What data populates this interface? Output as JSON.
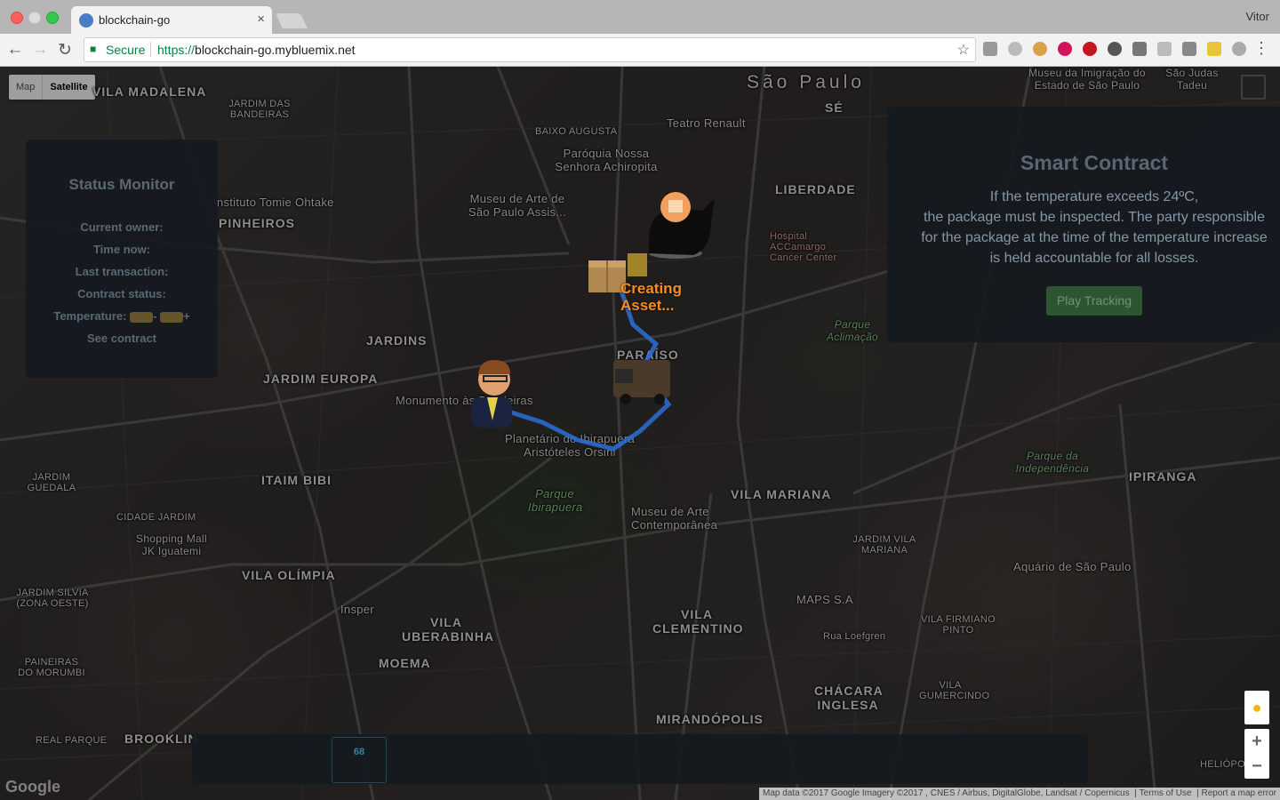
{
  "browser": {
    "tab_title": "blockchain-go",
    "tab_close": "×",
    "profile_name": "Vitor",
    "secure_label": "Secure",
    "url_scheme": "https://",
    "url_host": "blockchain-go.mybluemix.net"
  },
  "map": {
    "type_options": [
      "Map",
      "Satellite"
    ],
    "selected_type": "Satellite",
    "labels": [
      "São Paulo",
      "SÉ",
      "VILA MADALENA",
      "JARDIM DAS BANDEIRAS",
      "LIBERDADE",
      "BAIXO AUGUSTA",
      "PINHEIROS",
      "JARDINS",
      "JARDIM EUROPA",
      "PARAÍSO",
      "ITAIM BIBI",
      "VILA MARIANA",
      "IPIRANGA",
      "VILA OLÍMPIA",
      "VILA UBERABINHA",
      "MOEMA",
      "VILA CLEMENTINO",
      "MIRANDÓPOLIS",
      "BROOKLIN",
      "CHÁCARA INGLESA",
      "JARDIM GUEDALA",
      "CIDADE JARDIM",
      "Teatro Renault",
      "Paróquia Nossa Senhora Achiropita",
      "Museu de Arte de São Paulo Assis...",
      "Instituto Tomie Ohtake",
      "Hospital ACCamargo Cancer Center",
      "Monumento às Bandeiras",
      "Planetário do Ibirapuera Aristóteles Orsini",
      "Parque Ibirapuera",
      "Museu de Arte Contemporânea",
      "Shopping Mall JK Iguatemi",
      "Parque da Independência",
      "Aquário de São Paulo",
      "MAPS S.A",
      "Parque Aclimação",
      "Museu da Imigração do Estado de São Paulo",
      "São Judas Tadeu",
      "VILA FIRMIANO PINTO",
      "VILA GUMERCINDO",
      "JARDIM VILA MARIANA",
      "REAL PARQUE",
      "PAINEIRAS DO MORUMBI",
      "JARDIM SILVIA (ZONA OESTE)",
      "Insper",
      "Rua Loefgren",
      "HELIÓPOLIS"
    ],
    "attribution": "Map data ©2017 Google Imagery ©2017 , CNES / Airbus, DigitalGlobe, Landsat / Copernicus",
    "terms": "Terms of Use",
    "report": "Report a map error",
    "logo": "Google",
    "marker_status": [
      "Creating",
      "Asset..."
    ]
  },
  "status_monitor": {
    "title": "Status Monitor",
    "current_owner": "Current owner:",
    "time_now": "Time now:",
    "last_transaction": "Last transaction:",
    "contract_status": "Contract status:",
    "temperature_label": "Temperature:",
    "temp_minus": "-",
    "temp_plus": "+",
    "see_contract": "See contract"
  },
  "smart_contract": {
    "title": "Smart Contract",
    "lines": [
      "If the temperature exceeds 24ºC,",
      "the package must be inspected. The party responsible",
      "for the package at the time of the temperature increase",
      "is held accountable for all losses."
    ],
    "play_button": "Play Tracking"
  },
  "bottom_bar": {
    "temperature_value": "68"
  },
  "colors": {
    "panel_bg": "#151a20",
    "marker_text": "#ff8c1a",
    "route": "#2a6fd6"
  }
}
